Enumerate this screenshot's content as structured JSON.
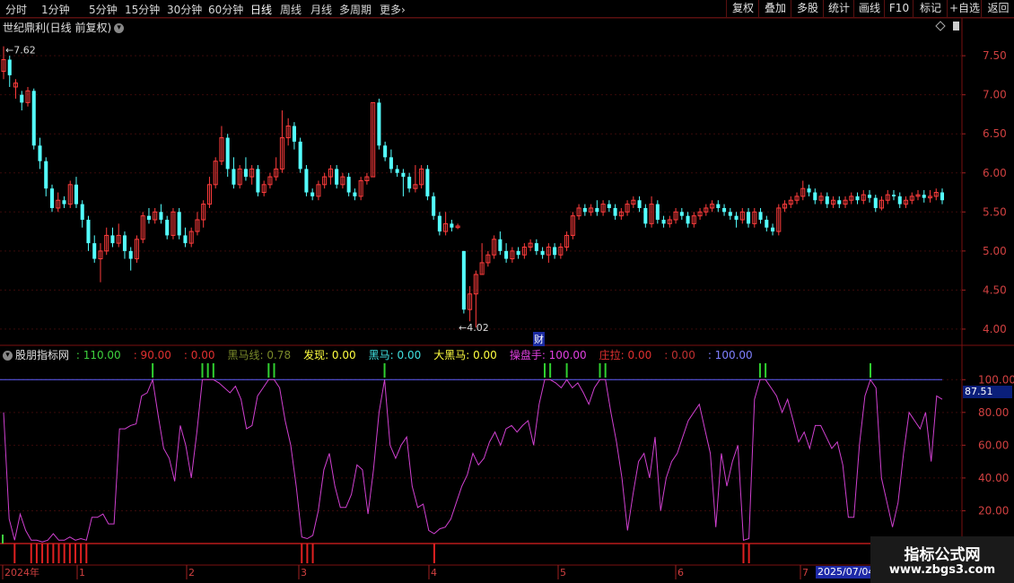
{
  "toolbar": {
    "timeframes": [
      "分时",
      "1分钟",
      "5分钟",
      "15分钟",
      "30分钟",
      "60分钟",
      "日线",
      "周线",
      "月线",
      "多周期",
      "更多"
    ],
    "active": "日线",
    "more_arrow": "›",
    "right_buttons": [
      "复权",
      "叠加",
      "多股",
      "统计",
      "画线",
      "F10",
      "+自选",
      "返回"
    ]
  },
  "main": {
    "stock_title": "世纪鼎利(日线 前复权)",
    "dropdown_icon": "chevron-down-icon",
    "price_axis": [
      "7.50",
      "7.00",
      "6.50",
      "6.00",
      "5.50",
      "5.00",
      "4.50",
      "4.00"
    ],
    "high_label": "7.62",
    "low_label": "4.02",
    "cai_badge": "财"
  },
  "indicator": {
    "name": "股朋指标网",
    "items": [
      {
        "label": ": 110.00",
        "color": "#3ed13e"
      },
      {
        "label": ": 90.00",
        "color": "#e03030"
      },
      {
        "label": ": 0.00",
        "color": "#e03030"
      },
      {
        "label": "黑马线: 0.78",
        "color": "#7a8a2a"
      },
      {
        "label": "发现: 0.00",
        "color": "#ffff40"
      },
      {
        "label": "黑马: 0.00",
        "color": "#40e0e0"
      },
      {
        "label": "大黑马: 0.00",
        "color": "#ffff40"
      },
      {
        "label": "操盘手: 100.00",
        "color": "#e040e0"
      },
      {
        "label": "庄拉: 0.00",
        "color": "#e03030"
      },
      {
        "label": ": 0.00",
        "color": "#c03030"
      },
      {
        "label": ": 100.00",
        "color": "#8080ff"
      }
    ],
    "axis": [
      "100.00",
      "80.00",
      "60.00",
      "40.00",
      "20.00"
    ],
    "current_value": "87.51"
  },
  "date_axis": {
    "labels": [
      "2024年",
      "1",
      "2",
      "3",
      "4",
      "5",
      "6",
      "7"
    ],
    "current_date": "2025/07/04"
  },
  "watermark": {
    "line1": "指标公式网",
    "line2": "www.zbgs3.com"
  },
  "colors": {
    "up": "#ff3c3c",
    "down": "#54ffff",
    "line": "#d040d0",
    "signal_green": "#30d030",
    "signal_red": "#e02020",
    "ref_line": "#6060ff"
  },
  "chart_data": {
    "type": "candlestick",
    "price_ylim": [
      3.85,
      7.8
    ],
    "candles": [
      [
        7.3,
        7.45,
        7.62,
        7.2
      ],
      [
        7.45,
        7.25,
        7.5,
        7.1
      ],
      [
        7.1,
        7.15,
        7.2,
        6.95
      ],
      [
        7.0,
        6.9,
        7.05,
        6.8
      ],
      [
        6.9,
        7.05,
        7.1,
        6.85
      ],
      [
        7.05,
        6.35,
        7.08,
        6.3
      ],
      [
        6.35,
        6.15,
        6.45,
        6.05
      ],
      [
        6.15,
        5.8,
        6.2,
        5.7
      ],
      [
        5.8,
        5.55,
        5.85,
        5.5
      ],
      [
        5.55,
        5.65,
        5.75,
        5.5
      ],
      [
        5.65,
        5.6,
        5.7,
        5.55
      ],
      [
        5.6,
        5.85,
        5.9,
        5.55
      ],
      [
        5.85,
        5.6,
        5.95,
        5.55
      ],
      [
        5.6,
        5.4,
        5.65,
        5.3
      ],
      [
        5.4,
        5.1,
        5.45,
        5.0
      ],
      [
        5.1,
        4.9,
        5.2,
        4.85
      ],
      [
        4.9,
        5.0,
        5.1,
        4.6
      ],
      [
        5.0,
        5.2,
        5.3,
        4.95
      ],
      [
        5.2,
        5.1,
        5.3,
        5.05
      ],
      [
        5.1,
        5.2,
        5.35,
        5.05
      ],
      [
        5.2,
        5.0,
        5.25,
        4.9
      ],
      [
        5.0,
        4.9,
        5.05,
        4.75
      ],
      [
        4.9,
        5.15,
        5.2,
        4.85
      ],
      [
        5.15,
        5.45,
        5.5,
        5.1
      ],
      [
        5.45,
        5.4,
        5.55,
        5.35
      ],
      [
        5.4,
        5.5,
        5.55,
        5.35
      ],
      [
        5.5,
        5.4,
        5.6,
        5.35
      ],
      [
        5.4,
        5.2,
        5.45,
        5.15
      ],
      [
        5.2,
        5.5,
        5.55,
        5.15
      ],
      [
        5.5,
        5.2,
        5.55,
        5.15
      ],
      [
        5.2,
        5.1,
        5.3,
        5.05
      ],
      [
        5.1,
        5.25,
        5.3,
        5.05
      ],
      [
        5.25,
        5.4,
        5.5,
        5.2
      ],
      [
        5.4,
        5.6,
        5.65,
        5.3
      ],
      [
        5.6,
        5.85,
        5.95,
        5.55
      ],
      [
        5.85,
        6.15,
        6.2,
        5.8
      ],
      [
        6.15,
        6.45,
        6.6,
        6.1
      ],
      [
        6.45,
        6.05,
        6.5,
        5.95
      ],
      [
        6.05,
        5.85,
        6.2,
        5.8
      ],
      [
        5.85,
        6.05,
        6.1,
        5.8
      ],
      [
        6.05,
        5.95,
        6.2,
        5.9
      ],
      [
        5.95,
        6.05,
        6.1,
        5.85
      ],
      [
        6.05,
        5.75,
        6.1,
        5.7
      ],
      [
        5.75,
        5.85,
        5.9,
        5.7
      ],
      [
        5.85,
        5.95,
        6.0,
        5.8
      ],
      [
        5.95,
        6.05,
        6.2,
        5.9
      ],
      [
        6.05,
        6.45,
        6.8,
        6.0
      ],
      [
        6.45,
        6.6,
        6.7,
        6.35
      ],
      [
        6.6,
        6.4,
        6.65,
        6.3
      ],
      [
        6.4,
        6.05,
        6.45,
        6.0
      ],
      [
        6.05,
        5.75,
        6.1,
        5.7
      ],
      [
        5.75,
        5.7,
        5.8,
        5.65
      ],
      [
        5.7,
        5.85,
        5.9,
        5.65
      ],
      [
        5.85,
        5.95,
        6.0,
        5.8
      ],
      [
        5.95,
        6.05,
        6.1,
        5.85
      ],
      [
        6.05,
        5.85,
        6.1,
        5.8
      ],
      [
        5.85,
        5.95,
        6.0,
        5.8
      ],
      [
        5.95,
        5.75,
        6.0,
        5.7
      ],
      [
        5.75,
        5.7,
        5.8,
        5.65
      ],
      [
        5.7,
        5.9,
        5.95,
        5.65
      ],
      [
        5.9,
        5.95,
        6.0,
        5.85
      ],
      [
        5.95,
        6.9,
        6.9,
        5.95
      ],
      [
        6.9,
        6.35,
        6.95,
        6.3
      ],
      [
        6.35,
        6.2,
        6.4,
        6.15
      ],
      [
        6.2,
        6.05,
        6.3,
        6.0
      ],
      [
        6.05,
        6.0,
        6.1,
        5.95
      ],
      [
        6.0,
        5.95,
        6.05,
        5.7
      ],
      [
        5.95,
        5.8,
        6.0,
        5.75
      ],
      [
        5.8,
        5.85,
        6.1,
        5.75
      ],
      [
        5.85,
        6.05,
        6.1,
        5.8
      ],
      [
        6.05,
        5.7,
        6.1,
        5.65
      ],
      [
        5.7,
        5.45,
        5.75,
        5.4
      ],
      [
        5.45,
        5.25,
        5.5,
        5.2
      ],
      [
        5.25,
        5.35,
        5.5,
        5.2
      ],
      [
        5.35,
        5.3,
        5.4,
        5.25
      ],
      [
        5.3,
        5.32,
        5.35,
        5.28
      ],
      [
        5.0,
        4.25,
        5.0,
        4.2
      ],
      [
        4.25,
        4.45,
        4.55,
        4.1
      ],
      [
        4.45,
        4.7,
        4.75,
        4.02
      ],
      [
        4.7,
        4.85,
        5.1,
        4.7
      ],
      [
        4.85,
        4.95,
        5.0,
        4.8
      ],
      [
        4.95,
        5.15,
        5.2,
        4.9
      ],
      [
        5.15,
        5.0,
        5.25,
        4.95
      ],
      [
        5.0,
        4.9,
        5.1,
        4.85
      ],
      [
        4.9,
        5.0,
        5.05,
        4.85
      ],
      [
        5.0,
        4.95,
        5.05,
        4.9
      ],
      [
        4.95,
        5.05,
        5.1,
        4.9
      ],
      [
        5.05,
        5.1,
        5.15,
        5.0
      ],
      [
        5.1,
        5.0,
        5.15,
        4.95
      ],
      [
        5.0,
        4.95,
        5.05,
        4.9
      ],
      [
        4.95,
        5.05,
        5.1,
        4.85
      ],
      [
        5.05,
        4.95,
        5.1,
        4.9
      ],
      [
        4.95,
        5.05,
        5.1,
        4.9
      ],
      [
        5.05,
        5.2,
        5.25,
        5.0
      ],
      [
        5.2,
        5.45,
        5.5,
        5.15
      ],
      [
        5.45,
        5.55,
        5.6,
        5.4
      ],
      [
        5.55,
        5.5,
        5.6,
        5.45
      ],
      [
        5.5,
        5.55,
        5.6,
        5.45
      ],
      [
        5.55,
        5.5,
        5.65,
        5.45
      ],
      [
        5.5,
        5.6,
        5.65,
        5.45
      ],
      [
        5.6,
        5.55,
        5.65,
        5.5
      ],
      [
        5.55,
        5.45,
        5.6,
        5.4
      ],
      [
        5.45,
        5.5,
        5.55,
        5.4
      ],
      [
        5.5,
        5.6,
        5.65,
        5.45
      ],
      [
        5.6,
        5.65,
        5.7,
        5.55
      ],
      [
        5.65,
        5.55,
        5.7,
        5.5
      ],
      [
        5.55,
        5.35,
        5.6,
        5.3
      ],
      [
        5.35,
        5.6,
        5.7,
        5.3
      ],
      [
        5.6,
        5.4,
        5.65,
        5.35
      ],
      [
        5.4,
        5.35,
        5.45,
        5.3
      ],
      [
        5.35,
        5.4,
        5.45,
        5.3
      ],
      [
        5.4,
        5.5,
        5.55,
        5.35
      ],
      [
        5.5,
        5.45,
        5.55,
        5.4
      ],
      [
        5.45,
        5.35,
        5.5,
        5.3
      ],
      [
        5.35,
        5.45,
        5.5,
        5.3
      ],
      [
        5.45,
        5.5,
        5.55,
        5.4
      ],
      [
        5.5,
        5.55,
        5.6,
        5.45
      ],
      [
        5.55,
        5.6,
        5.65,
        5.5
      ],
      [
        5.6,
        5.55,
        5.65,
        5.5
      ],
      [
        5.55,
        5.5,
        5.6,
        5.45
      ],
      [
        5.5,
        5.45,
        5.55,
        5.4
      ],
      [
        5.45,
        5.4,
        5.5,
        5.3
      ],
      [
        5.4,
        5.5,
        5.55,
        5.35
      ],
      [
        5.5,
        5.35,
        5.55,
        5.3
      ],
      [
        5.35,
        5.5,
        5.55,
        5.3
      ],
      [
        5.5,
        5.4,
        5.55,
        5.35
      ],
      [
        5.4,
        5.3,
        5.45,
        5.25
      ],
      [
        5.3,
        5.25,
        5.35,
        5.2
      ],
      [
        5.25,
        5.55,
        5.6,
        5.2
      ],
      [
        5.55,
        5.6,
        5.65,
        5.5
      ],
      [
        5.6,
        5.65,
        5.7,
        5.55
      ],
      [
        5.65,
        5.7,
        5.75,
        5.6
      ],
      [
        5.7,
        5.8,
        5.9,
        5.65
      ],
      [
        5.8,
        5.75,
        5.85,
        5.7
      ],
      [
        5.75,
        5.65,
        5.8,
        5.6
      ],
      [
        5.65,
        5.7,
        5.75,
        5.6
      ],
      [
        5.7,
        5.6,
        5.75,
        5.55
      ],
      [
        5.6,
        5.65,
        5.7,
        5.55
      ],
      [
        5.65,
        5.6,
        5.7,
        5.55
      ],
      [
        5.6,
        5.65,
        5.7,
        5.55
      ],
      [
        5.65,
        5.7,
        5.75,
        5.6
      ],
      [
        5.7,
        5.65,
        5.75,
        5.6
      ],
      [
        5.65,
        5.72,
        5.78,
        5.6
      ],
      [
        5.72,
        5.68,
        5.78,
        5.62
      ],
      [
        5.68,
        5.55,
        5.72,
        5.5
      ],
      [
        5.55,
        5.65,
        5.7,
        5.52
      ],
      [
        5.65,
        5.72,
        5.78,
        5.6
      ],
      [
        5.72,
        5.7,
        5.78,
        5.65
      ],
      [
        5.7,
        5.6,
        5.75,
        5.55
      ],
      [
        5.6,
        5.65,
        5.7,
        5.55
      ],
      [
        5.65,
        5.7,
        5.75,
        5.6
      ],
      [
        5.7,
        5.72,
        5.78,
        5.65
      ],
      [
        5.72,
        5.68,
        5.78,
        5.62
      ],
      [
        5.68,
        5.7,
        5.78,
        5.62
      ],
      [
        5.7,
        5.75,
        5.8,
        5.65
      ],
      [
        5.75,
        5.65,
        5.8,
        5.6
      ]
    ],
    "indicator_ylim": [
      0,
      110
    ],
    "indicator_line": [
      80,
      15,
      2,
      18,
      8,
      2,
      2,
      1,
      2,
      6,
      2,
      2,
      4,
      2,
      3,
      2,
      16,
      16,
      18,
      12,
      12,
      70,
      70,
      72,
      73,
      90,
      92,
      100,
      78,
      58,
      52,
      38,
      72,
      60,
      40,
      68,
      100,
      100,
      100,
      98,
      95,
      92,
      96,
      88,
      70,
      72,
      90,
      95,
      100,
      100,
      95,
      75,
      60,
      35,
      4,
      3,
      5,
      20,
      45,
      55,
      35,
      22,
      22,
      30,
      48,
      45,
      18,
      45,
      80,
      100,
      60,
      52,
      60,
      65,
      35,
      22,
      24,
      8,
      6,
      9,
      10,
      15,
      25,
      35,
      42,
      55,
      48,
      52,
      62,
      68,
      60,
      70,
      72,
      68,
      72,
      75,
      60,
      85,
      100,
      100,
      98,
      95,
      100,
      95,
      98,
      92,
      85,
      95,
      100,
      100,
      80,
      62,
      40,
      8,
      30,
      50,
      55,
      40,
      65,
      20,
      40,
      50,
      55,
      65,
      75,
      80,
      85,
      70,
      55,
      10,
      55,
      35,
      50,
      60,
      2,
      3,
      88,
      100,
      100,
      95,
      90,
      80,
      88,
      75,
      62,
      68,
      58,
      72,
      72,
      65,
      58,
      62,
      48,
      16,
      16,
      60,
      90,
      100,
      95,
      40,
      25,
      10,
      25,
      55,
      80,
      75,
      70,
      80,
      50,
      90,
      88
    ]
  }
}
